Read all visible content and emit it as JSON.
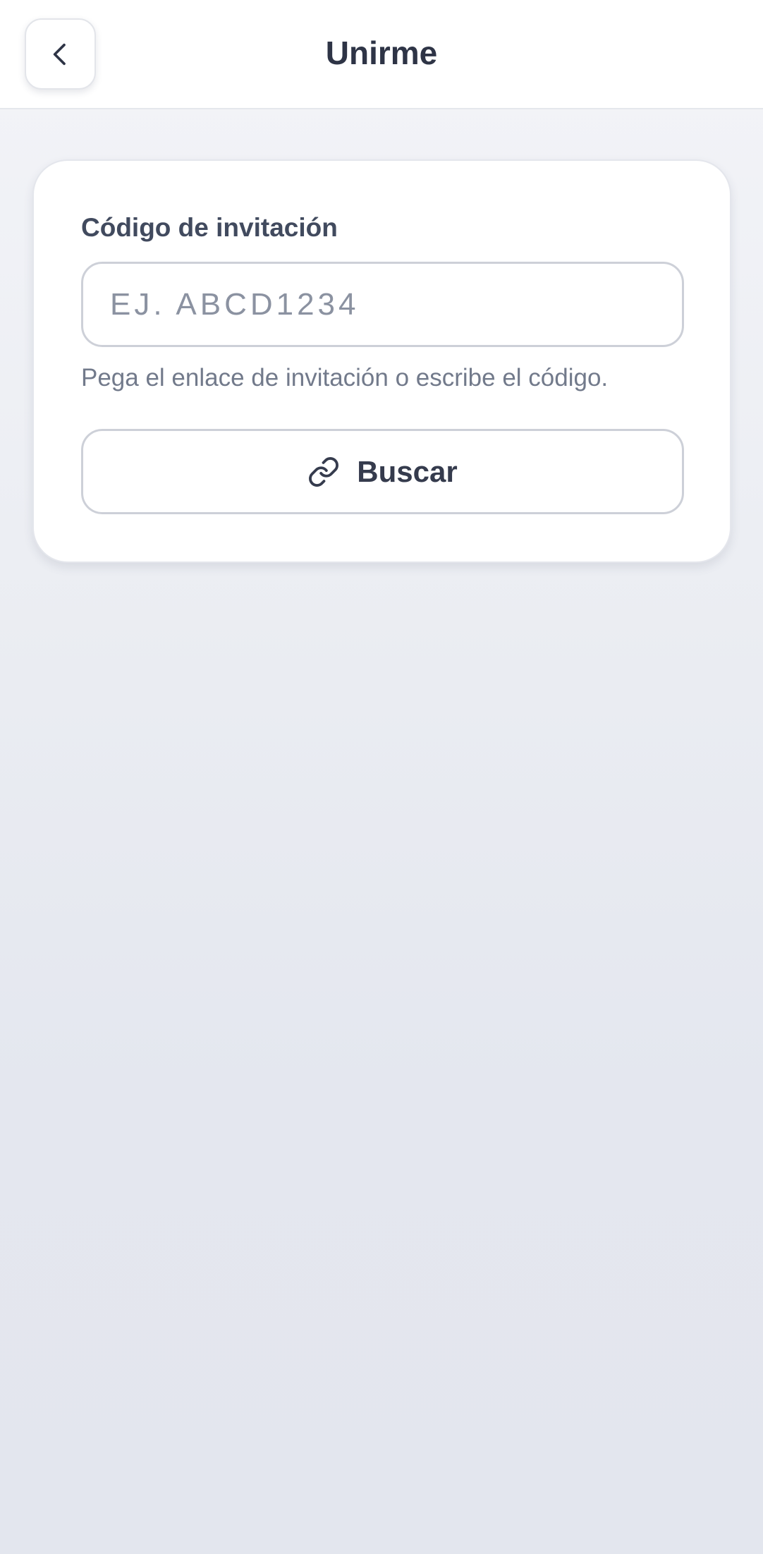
{
  "header": {
    "title": "Unirme",
    "back_icon": "chevron-left-icon"
  },
  "form": {
    "label": "Código de invitación",
    "input_placeholder": "EJ. ABCD1234",
    "input_value": "",
    "helper_text": "Pega el enlace de invitación o escribe el código.",
    "button_label": "Buscar",
    "button_icon": "link-icon"
  },
  "colors": {
    "text_primary": "#2e3446",
    "text_secondary": "#727a8b",
    "border": "#cdd0d8",
    "background": "#e4e7ef"
  }
}
